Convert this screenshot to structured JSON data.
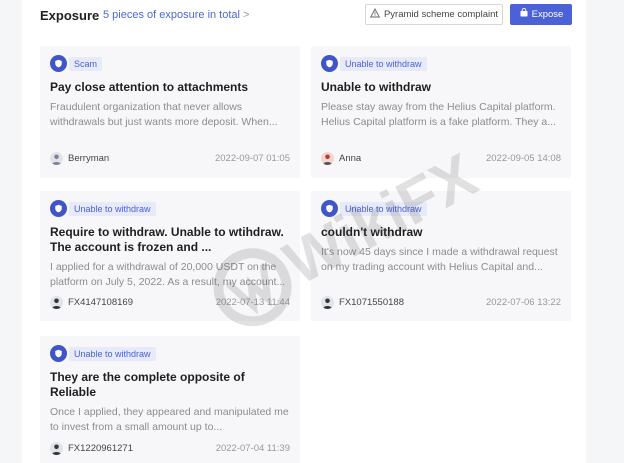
{
  "header": {
    "title": "Exposure",
    "count_text": "5 pieces of exposure in total",
    "complaint_label": "Pyramid scheme complaint",
    "expose_label": "Expose"
  },
  "cards": [
    {
      "tag": "Scam",
      "title": "Pay close attention to attachments",
      "body": "Fraudulent organization that never allows withdrawals but just wants more deposit. When...",
      "author": "Berryman",
      "date": "2022-09-07 01:05"
    },
    {
      "tag": "Unable to withdraw",
      "title": "Unable to withdraw",
      "body": "Please stay away from the Helius Capital platform. Helius Capital platform is a fake platform. They a...",
      "author": "Anna",
      "date": "2022-09-05 14:08"
    },
    {
      "tag": "Unable to withdraw",
      "title": "Require to withdraw. Unable to wtihdraw. The account is frozen and ...",
      "body": "I applied for a withdrawal of 20,000 USDT on the platform on July 5, 2022. As a result, my account...",
      "author": "FX4147108169",
      "date": "2022-07-13 11:44"
    },
    {
      "tag": "Unable to withdraw",
      "title": "couldn't withdraw",
      "body": "It's now 45 days since I made a withdrawal request on my trading account with Helius Capital and...",
      "author": "FX1071550188",
      "date": "2022-07-06 13:22"
    },
    {
      "tag": "Unable to withdraw",
      "title": "They are the complete opposite of Reliable",
      "body": "Once I applied, they appeared and manipulated me to invest from a small amount up to...",
      "author": "FX1220961271",
      "date": "2022-07-04 11:39"
    }
  ],
  "watermark_text": "WikiFX",
  "colors": {
    "accent": "#4a62d6",
    "card_bg": "#f7f7f9",
    "muted": "#8c8c8c"
  }
}
